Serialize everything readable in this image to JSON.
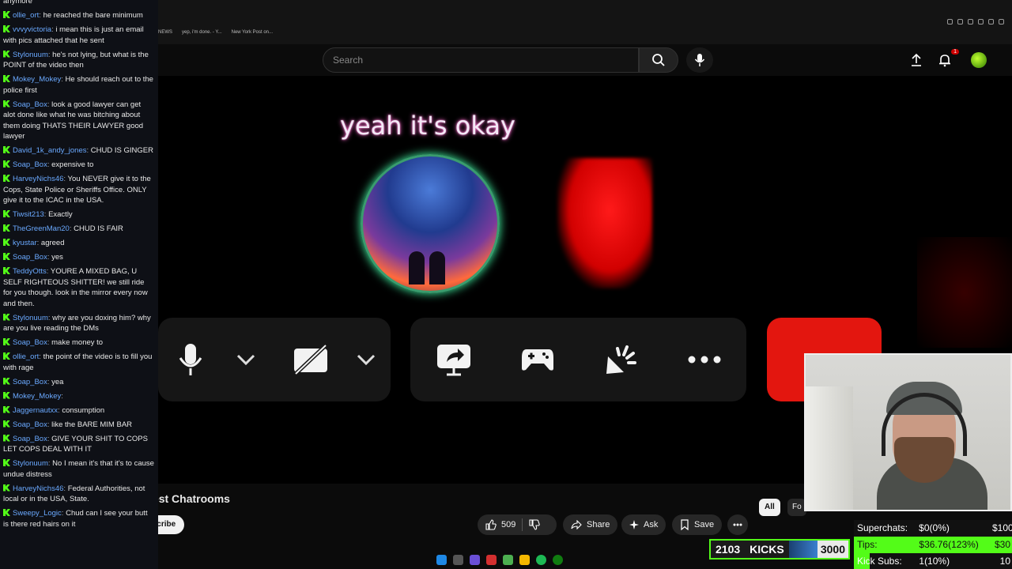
{
  "chat": {
    "first_line": "anymore",
    "messages": [
      {
        "user": "ollie_ort",
        "text": "he reached the bare minimum"
      },
      {
        "user": "vvvyvictoria",
        "text": "i mean this is just an email with pics attached that he sent"
      },
      {
        "user": "Stylonuum",
        "text": "he's not lying, but what is the POINT of the video then"
      },
      {
        "user": "Mokey_Mokey",
        "text": "He should reach out to the police first"
      },
      {
        "user": "Soap_Box",
        "text": "look a good lawyer can get alot done like what he was bitching about them doing THATS THEIR LAWYER good lawyer"
      },
      {
        "user": "David_1k_andy_jones",
        "text": "CHUD IS GINGER"
      },
      {
        "user": "Soap_Box",
        "text": "expensive to"
      },
      {
        "user": "HarveyNichs46",
        "text": "You NEVER give it to the Cops, State Police or Sheriffs Office. ONLY give it to the ICAC in the USA."
      },
      {
        "user": "Tiwsit213",
        "text": "Exactly"
      },
      {
        "user": "TheGreenMan20",
        "text": "CHUD IS FAIR"
      },
      {
        "user": "kyustar",
        "text": "agreed"
      },
      {
        "user": "Soap_Box",
        "text": "yes"
      },
      {
        "user": "TeddyOtts",
        "text": "YOURE A MIXED BAG, U SELF RIGHTEOUS SHITTER! we still ride for you though. look in the mirror every now and then."
      },
      {
        "user": "Stylonuum",
        "text": "why are you doxing him? why are you live reading the DMs"
      },
      {
        "user": "Soap_Box",
        "text": "make money to"
      },
      {
        "user": "ollie_ort",
        "text": "the point of the video is to fill you with rage"
      },
      {
        "user": "Soap_Box",
        "text": "yea"
      },
      {
        "user": "Mokey_Mokey",
        "text": ""
      },
      {
        "user": "Jaggernautxx",
        "text": "consumption"
      },
      {
        "user": "Soap_Box",
        "text": "like the BARE MIM BAR"
      },
      {
        "user": "Soap_Box",
        "text": "GIVE YOUR SHIT TO COPS LET COPS DEAL WITH IT"
      },
      {
        "user": "Stylonuum",
        "text": "No I mean it's that it's to cause undue distress"
      },
      {
        "user": "HarveyNichs46",
        "text": "Federal Authorities, not local or in the USA, State."
      },
      {
        "user": "Sweepy_Logic",
        "text": "Chud can I see your butt is there red hairs on it"
      }
    ]
  },
  "browser": {
    "bookmarks": [
      "NEWS",
      "yep, i'm done. - Y...",
      "New York Post on..."
    ]
  },
  "youtube": {
    "search_placeholder": "Search",
    "notif_count": "1",
    "video_title": "Inside the Internet's Oldest Chatrooms",
    "subscribe": "Subscribe",
    "likes": "509",
    "share": "Share",
    "ask": "Ask",
    "save": "Save",
    "chip_all": "All",
    "chip_2": "Fo"
  },
  "video": {
    "caption": "yeah it's okay"
  },
  "overlay": {
    "kicks_count": "2103",
    "kicks_label": "KICKS",
    "kicks_goal": "3000",
    "goals": [
      {
        "name": "Superchats:",
        "value": "$0(0%)",
        "target": "$100",
        "progress": 0
      },
      {
        "name": "Tips:",
        "value": "$36.76(123%)",
        "target": "$30",
        "progress": 1.0
      },
      {
        "name": "Kick Subs:",
        "value": "1(10%)",
        "target": "10",
        "progress": 0.1
      }
    ]
  },
  "colors": {
    "kick_green": "#53fc18",
    "youtube_red": "#e3160f",
    "chat_user": "#6aa9ff"
  }
}
